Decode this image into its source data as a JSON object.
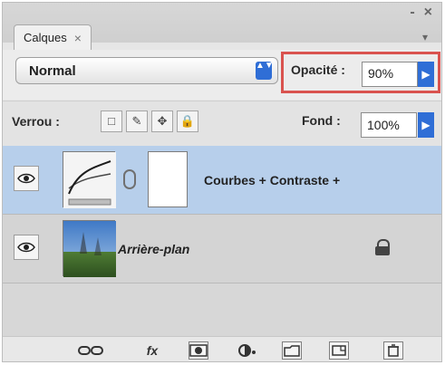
{
  "panel": {
    "tab_label": "Calques",
    "tab_close": "×",
    "win_controls": [
      "-",
      "×"
    ],
    "menu_glyph": "▾"
  },
  "blend": {
    "mode_value": "Normal",
    "arrows": "▲▼"
  },
  "opacity": {
    "label": "Opacité :",
    "value": "90%",
    "arrow": "▶"
  },
  "lock": {
    "label": "Verrou :",
    "buttons": [
      "□",
      "✎",
      "✥",
      "🔒"
    ]
  },
  "fill": {
    "label": "Fond :",
    "value": "100%",
    "arrow": "▶"
  },
  "layers": [
    {
      "name": "Courbes + Contraste +",
      "selected": true
    },
    {
      "name": "Arrière-plan",
      "selected": false
    }
  ],
  "bottom_tools": [
    "link-layers",
    "fx",
    "add-mask",
    "adjustment",
    "group",
    "new-layer",
    "trash"
  ],
  "colors": {
    "accent_blue": "#2f6ed6",
    "highlight_red": "#d9534f",
    "selected_layer": "#b7cfeb"
  }
}
